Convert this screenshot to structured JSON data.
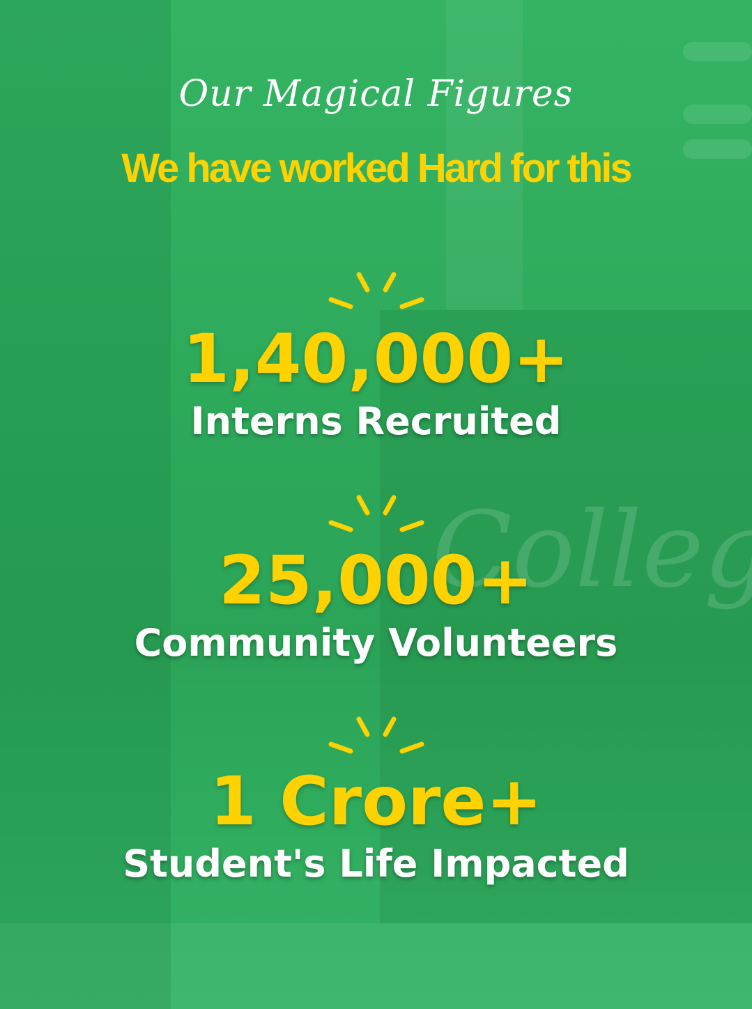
{
  "header": {
    "script_title": "Our Magical Figures",
    "subtitle": "We have worked Hard for this"
  },
  "background": {
    "watermark": "College"
  },
  "stats": [
    {
      "value": "1,40,000+",
      "label": "Interns Recruited"
    },
    {
      "value": "25,000+",
      "label": "Community Volunteers"
    },
    {
      "value": "1 Crore+",
      "label": "Student's Life Impacted"
    }
  ],
  "colors": {
    "background": "#2eae5c",
    "accent": "#ffd200",
    "label": "#ffffff"
  },
  "icons": [
    "sparkle-icon"
  ]
}
